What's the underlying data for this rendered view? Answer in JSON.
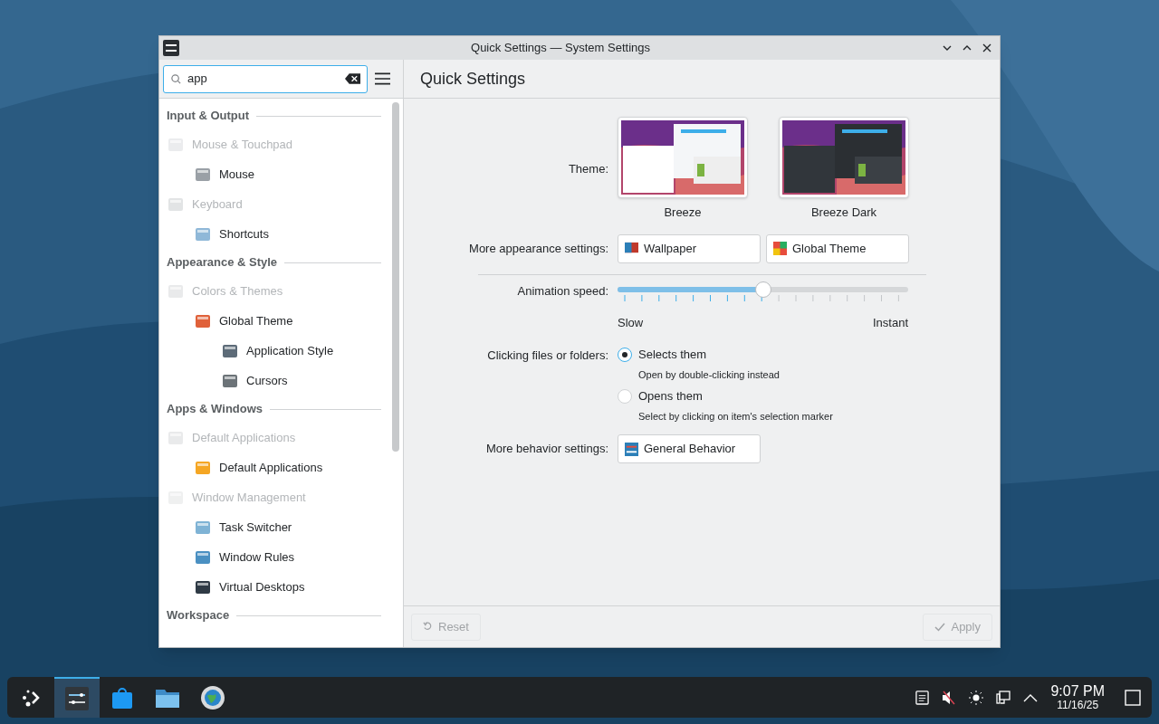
{
  "window": {
    "title": "Quick Settings — System Settings"
  },
  "search": {
    "value": "app"
  },
  "page_title": "Quick Settings",
  "sidebar": {
    "sections": [
      {
        "title": "Input & Output",
        "items": [
          {
            "label": "Mouse & Touchpad",
            "disabled": true,
            "children": [
              {
                "label": "Mouse",
                "disabled": false
              }
            ]
          },
          {
            "label": "Keyboard",
            "disabled": true,
            "children": [
              {
                "label": "Shortcuts",
                "disabled": false
              }
            ]
          }
        ]
      },
      {
        "title": "Appearance & Style",
        "items": [
          {
            "label": "Colors & Themes",
            "disabled": true,
            "children": [
              {
                "label": "Global Theme",
                "disabled": false,
                "children": [
                  {
                    "label": "Application Style",
                    "disabled": false
                  },
                  {
                    "label": "Cursors",
                    "disabled": false
                  }
                ]
              }
            ]
          }
        ]
      },
      {
        "title": "Apps & Windows",
        "items": [
          {
            "label": "Default Applications",
            "disabled": true,
            "children": [
              {
                "label": "Default Applications",
                "disabled": false
              }
            ]
          },
          {
            "label": "Window Management",
            "disabled": true,
            "children": [
              {
                "label": "Task Switcher",
                "disabled": false
              },
              {
                "label": "Window Rules",
                "disabled": false
              },
              {
                "label": "Virtual Desktops",
                "disabled": false
              }
            ]
          }
        ]
      },
      {
        "title": "Workspace"
      }
    ]
  },
  "theme": {
    "label": "Theme:",
    "options": [
      {
        "name": "Breeze",
        "kind": "light"
      },
      {
        "name": "Breeze Dark",
        "kind": "dark"
      }
    ]
  },
  "appearance": {
    "label": "More appearance settings:",
    "buttons": [
      "Wallpaper",
      "Global Theme"
    ]
  },
  "animation": {
    "label": "Animation speed:",
    "level": 0.5,
    "min_label": "Slow",
    "max_label": "Instant"
  },
  "clicking": {
    "label": "Clicking files or folders:",
    "options": [
      {
        "label": "Selects them",
        "hint": "Open by double-clicking instead",
        "selected": true
      },
      {
        "label": "Opens them",
        "hint": "Select by clicking on item's selection marker",
        "selected": false
      }
    ]
  },
  "behavior": {
    "label": "More behavior settings:",
    "button": "General Behavior"
  },
  "footer": {
    "reset": {
      "label": "Reset",
      "disabled": true
    },
    "apply": {
      "label": "Apply",
      "disabled": true
    }
  },
  "taskbar": {
    "apps": [
      {
        "active": true
      },
      {
        "active": false
      },
      {
        "active": false
      },
      {
        "active": false
      }
    ],
    "time": "9:07 PM",
    "date": "11/16/25"
  }
}
